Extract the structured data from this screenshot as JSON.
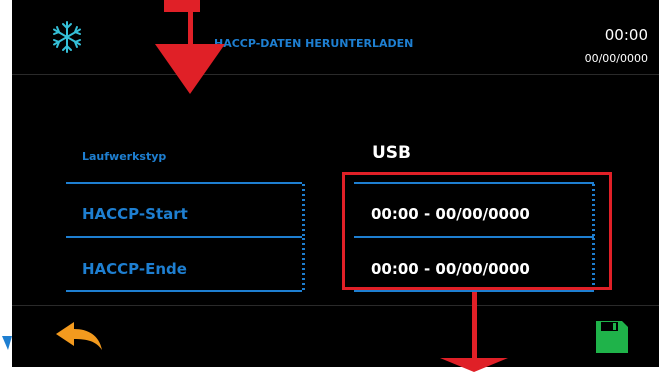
{
  "header": {
    "title": "HACCP-DATEN HERUNTERLADEN",
    "time": "00:00",
    "date": "00/00/0000"
  },
  "rows": [
    {
      "label": "Laufwerkstyp",
      "value": "USB"
    },
    {
      "label": "HACCP-Start",
      "value": "00:00 - 00/00/0000"
    },
    {
      "label": "HACCP-Ende",
      "value": "00:00 - 00/00/0000"
    }
  ],
  "icons": {
    "header": "snowflake-icon",
    "back": "back-arrow-icon",
    "save": "save-icon"
  },
  "colors": {
    "accent": "#1e7fd1",
    "annotation": "#e02027",
    "save": "#1fb34a",
    "back": "#f39a1e"
  }
}
